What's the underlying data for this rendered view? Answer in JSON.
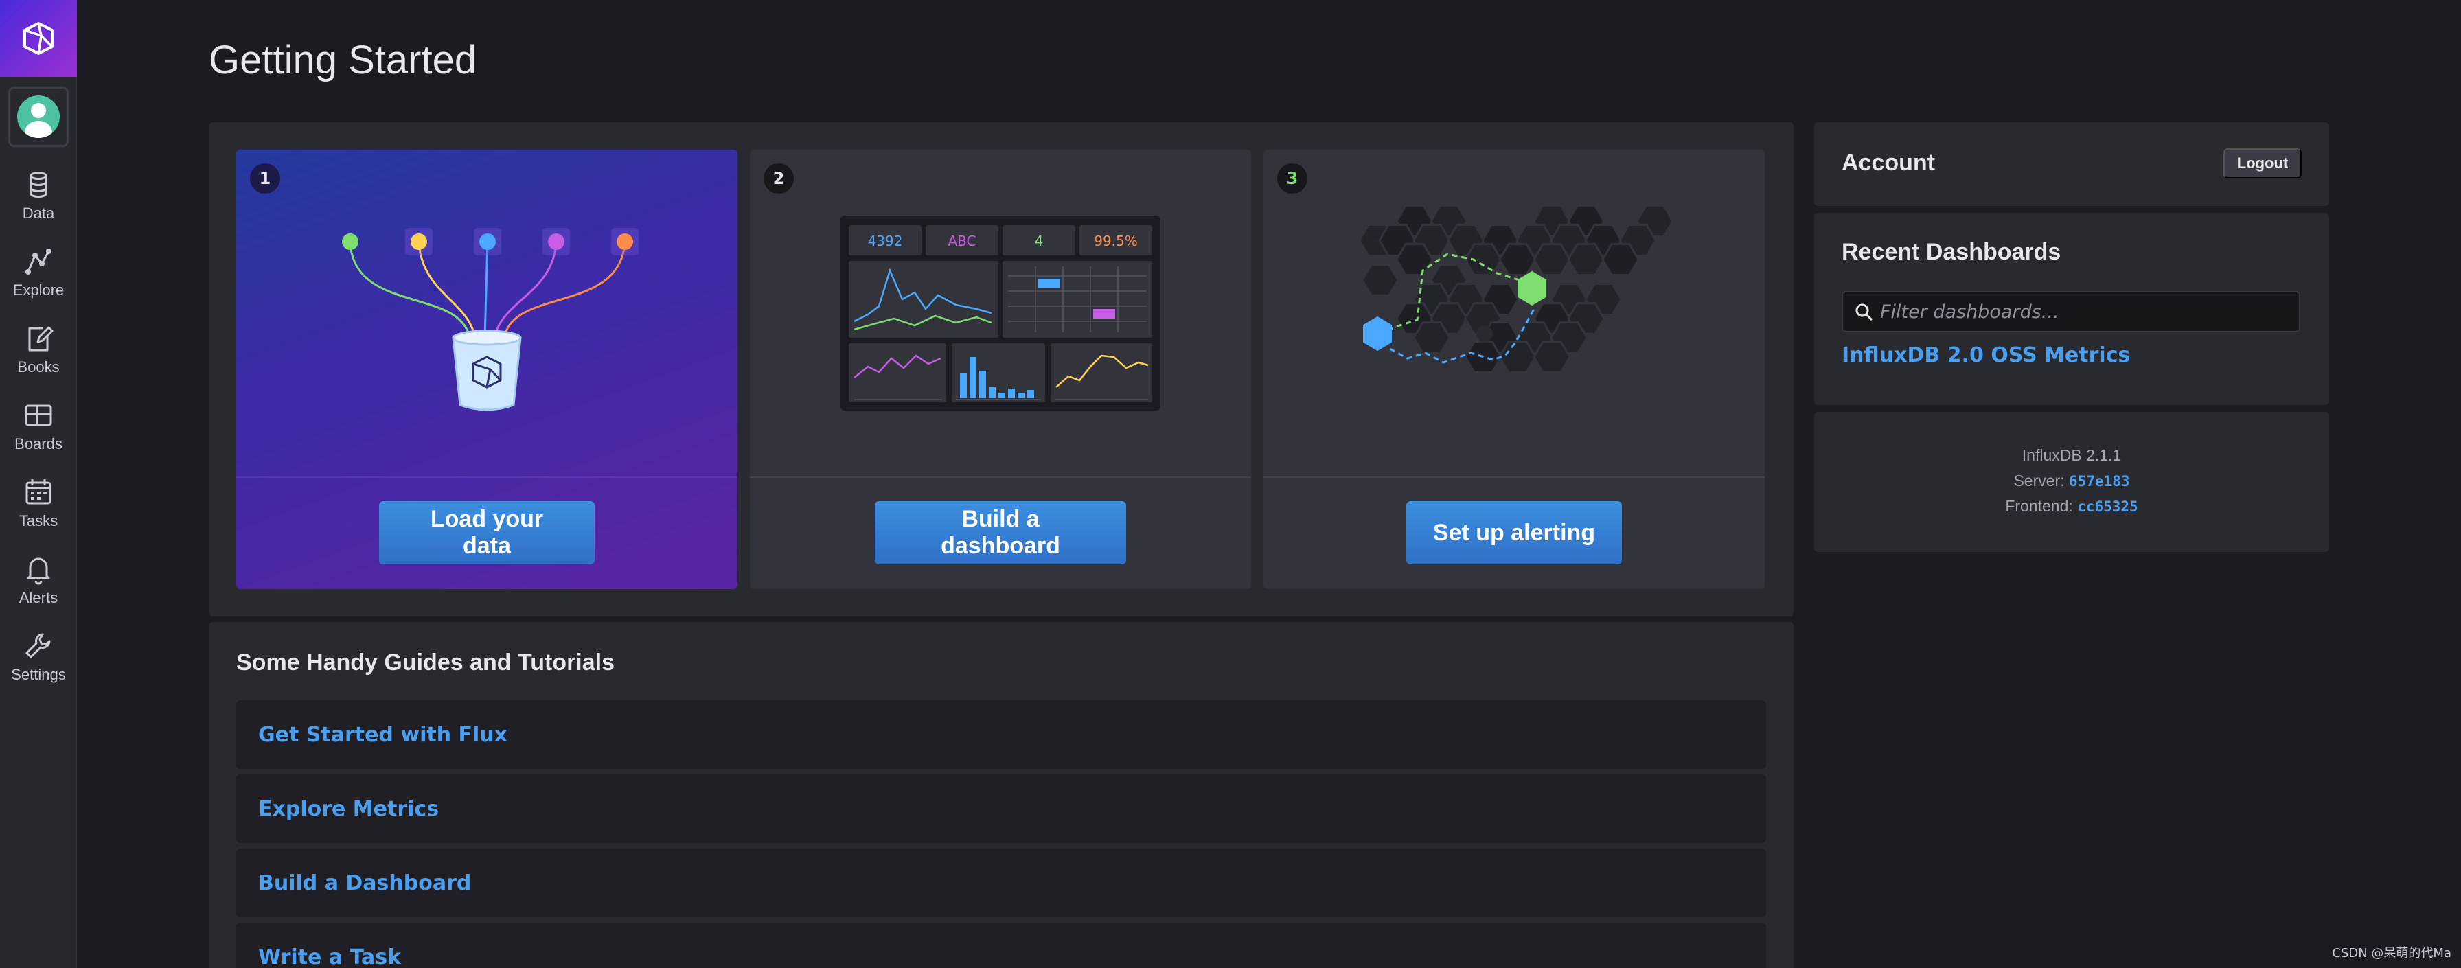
{
  "sidebar": {
    "items": [
      {
        "label": "Data",
        "icon": "database-icon"
      },
      {
        "label": "Explore",
        "icon": "graph-icon"
      },
      {
        "label": "Books",
        "icon": "notebook-icon"
      },
      {
        "label": "Boards",
        "icon": "dashboard-icon"
      },
      {
        "label": "Tasks",
        "icon": "calendar-icon"
      },
      {
        "label": "Alerts",
        "icon": "bell-icon"
      },
      {
        "label": "Settings",
        "icon": "wrench-icon"
      }
    ]
  },
  "page": {
    "title": "Getting Started"
  },
  "steps": [
    {
      "number": "1",
      "button": "Load your data"
    },
    {
      "number": "2",
      "button": "Build a dashboard",
      "illustration": {
        "stat1": "4392",
        "stat2": "ABC",
        "stat3": "4",
        "stat4": "99.5%"
      }
    },
    {
      "number": "3",
      "button": "Set up alerting"
    }
  ],
  "guides": {
    "title": "Some Handy Guides and Tutorials",
    "items": [
      "Get Started with Flux",
      "Explore Metrics",
      "Build a Dashboard",
      "Write a Task"
    ]
  },
  "account": {
    "title": "Account",
    "logout": "Logout"
  },
  "recent": {
    "title": "Recent Dashboards",
    "filter_placeholder": "Filter dashboards...",
    "dashboards": [
      "InfluxDB 2.0 OSS Metrics"
    ]
  },
  "version": {
    "product": "InfluxDB 2.1.1",
    "server_label": "Server:",
    "server_value": "657e183",
    "frontend_label": "Frontend:",
    "frontend_value": "cc65325"
  },
  "watermark": "CSDN @呆萌的代Ma",
  "colors": {
    "accent_blue": "#4a9ff0",
    "button_blue": "#3d8fe0",
    "brand_purple": "#9a31d3",
    "alert_green": "#7ddd6e"
  }
}
